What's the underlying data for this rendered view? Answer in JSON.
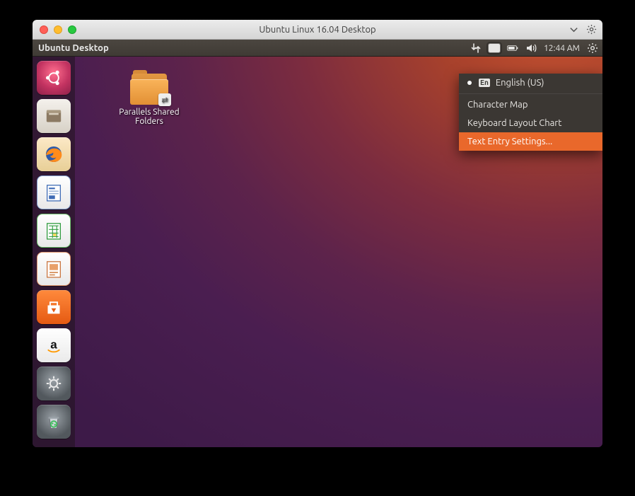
{
  "host_window": {
    "title": "Ubuntu Linux 16.04 Desktop"
  },
  "ubuntu_panel": {
    "title": "Ubuntu Desktop",
    "input_badge": "En",
    "time": "12:44 AM"
  },
  "desktop": {
    "icon_label": "Parallels Shared\nFolders"
  },
  "launcher": {
    "items": [
      {
        "name": "dash"
      },
      {
        "name": "files"
      },
      {
        "name": "firefox"
      },
      {
        "name": "writer"
      },
      {
        "name": "calc"
      },
      {
        "name": "impress"
      },
      {
        "name": "software"
      },
      {
        "name": "amazon"
      },
      {
        "name": "settings"
      },
      {
        "name": "trash"
      }
    ]
  },
  "dropdown": {
    "current_language_badge": "En",
    "items": [
      {
        "label": "English (US)",
        "radio": true
      },
      {
        "label": "Character Map"
      },
      {
        "label": "Keyboard Layout Chart"
      },
      {
        "label": "Text Entry Settings...",
        "highlight": true
      }
    ]
  }
}
